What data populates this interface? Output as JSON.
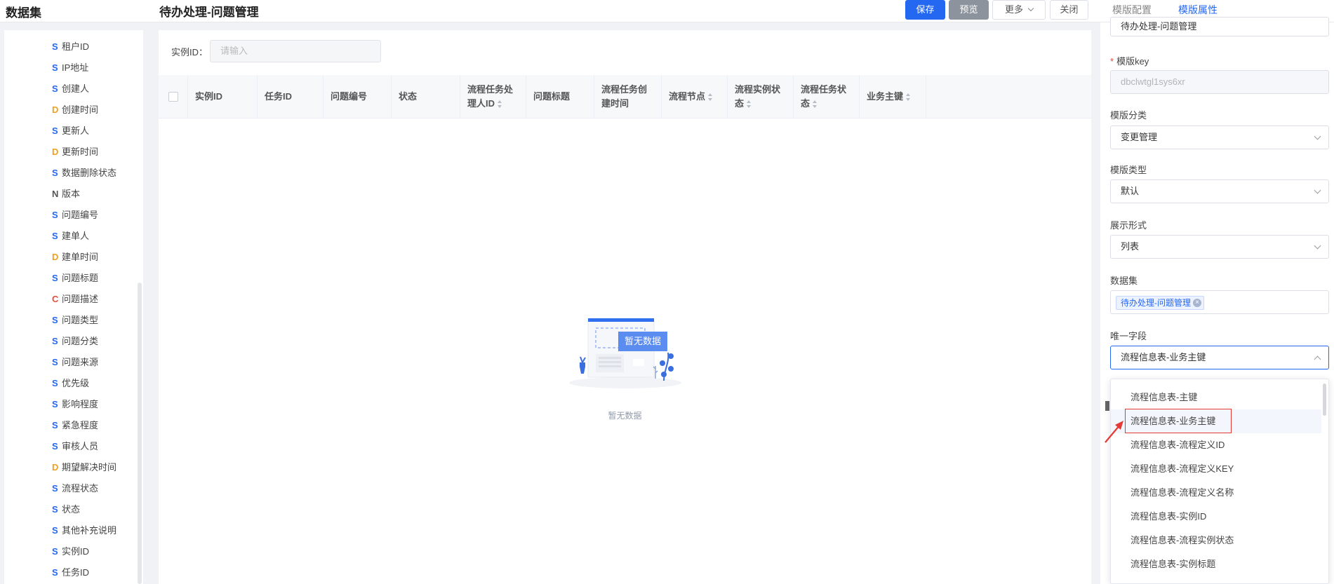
{
  "header": {
    "app_title": "数据集",
    "page_title": "待办处理-问题管理",
    "buttons": {
      "save": "保存",
      "preview": "预览",
      "more": "更多",
      "close": "关闭"
    },
    "right_tabs": {
      "config": "模版配置",
      "props": "模版属性"
    }
  },
  "sidebar": {
    "fields": [
      {
        "type": "S",
        "label": "租户ID"
      },
      {
        "type": "S",
        "label": "IP地址"
      },
      {
        "type": "S",
        "label": "创建人"
      },
      {
        "type": "D",
        "label": "创建时间"
      },
      {
        "type": "S",
        "label": "更新人"
      },
      {
        "type": "D",
        "label": "更新时间"
      },
      {
        "type": "S",
        "label": "数据删除状态"
      },
      {
        "type": "N",
        "label": "版本"
      },
      {
        "type": "S",
        "label": "问题编号"
      },
      {
        "type": "S",
        "label": "建单人"
      },
      {
        "type": "D",
        "label": "建单时间"
      },
      {
        "type": "S",
        "label": "问题标题"
      },
      {
        "type": "C",
        "label": "问题描述"
      },
      {
        "type": "S",
        "label": "问题类型"
      },
      {
        "type": "S",
        "label": "问题分类"
      },
      {
        "type": "S",
        "label": "问题来源"
      },
      {
        "type": "S",
        "label": "优先级"
      },
      {
        "type": "S",
        "label": "影响程度"
      },
      {
        "type": "S",
        "label": "紧急程度"
      },
      {
        "type": "S",
        "label": "审核人员"
      },
      {
        "type": "D",
        "label": "期望解决时间"
      },
      {
        "type": "S",
        "label": "流程状态"
      },
      {
        "type": "S",
        "label": "状态"
      },
      {
        "type": "S",
        "label": "其他补充说明"
      },
      {
        "type": "S",
        "label": "实例ID"
      },
      {
        "type": "S",
        "label": "任务ID"
      }
    ]
  },
  "main": {
    "filter": {
      "label": "实例ID：",
      "placeholder": "请输入"
    },
    "columns": [
      {
        "label": "实例ID",
        "sortable": false
      },
      {
        "label": "任务ID",
        "sortable": false
      },
      {
        "label": "问题编号",
        "sortable": false
      },
      {
        "label": "状态",
        "sortable": false
      },
      {
        "label": "流程任务处理人ID",
        "sortable": true
      },
      {
        "label": "问题标题",
        "sortable": false
      },
      {
        "label": "流程任务创建时间",
        "sortable": false
      },
      {
        "label": "流程节点",
        "sortable": true
      },
      {
        "label": "流程实例状态",
        "sortable": true
      },
      {
        "label": "流程任务状态",
        "sortable": true
      },
      {
        "label": "业务主键",
        "sortable": true
      }
    ],
    "empty_badge": "暂无数据",
    "empty_text": "暂无数据"
  },
  "right_panel": {
    "template_name_value": "待办处理-问题管理",
    "template_key_label": "模版key",
    "template_key_value": "dbclwtgl1sys6xr",
    "category_label": "模版分类",
    "category_value": "变更管理",
    "type_label": "模版类型",
    "type_value": "默认",
    "display_label": "展示形式",
    "display_value": "列表",
    "dataset_label": "数据集",
    "dataset_tag": "待办处理-问题管理",
    "unique_label": "唯一字段",
    "unique_value": "流程信息表-业务主键"
  },
  "dropdown": {
    "options": [
      "流程信息表-主键",
      "流程信息表-业务主键",
      "流程信息表-流程定义ID",
      "流程信息表-流程定义KEY",
      "流程信息表-流程定义名称",
      "流程信息表-实例ID",
      "流程信息表-流程实例状态",
      "流程信息表-实例标题"
    ],
    "selected": "流程信息表-业务主键"
  },
  "colors": {
    "primary": "#2468f2",
    "highlight": "#e53935",
    "type_S": "#2468f2",
    "type_D": "#f0a020",
    "type_C": "#e74c3c"
  }
}
